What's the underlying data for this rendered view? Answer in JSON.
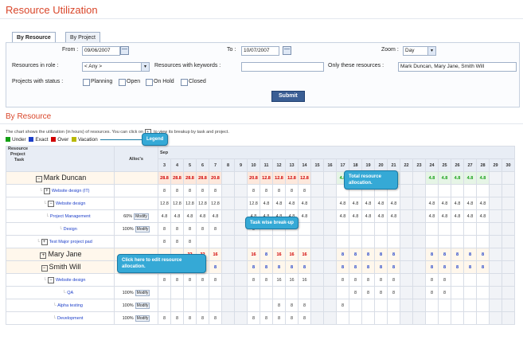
{
  "page": {
    "title": "Resource Utilization"
  },
  "tabs": [
    {
      "label": "By Resource",
      "active": true
    },
    {
      "label": "By Project",
      "active": false
    }
  ],
  "filters": {
    "from_label": "From :",
    "from_value": "09/06/2007",
    "to_label": "To :",
    "to_value": "10/07/2007",
    "zoom_label": "Zoom :",
    "zoom_value": "Day",
    "role_label": "Resources in role :",
    "role_value": "< Any >",
    "keywords_label": "Resources with keywords :",
    "keywords_value": "",
    "only_label": "Only these resources :",
    "only_value": "Mark Duncan, Mary Jane, Smith Will",
    "status_label": "Projects with status :",
    "statuses": [
      "Planning",
      "Open",
      "On Hold",
      "Closed"
    ],
    "submit_label": "Submit"
  },
  "section": {
    "title": "By Resource",
    "description": "The chart shows the utilization (in hours) of resources. You can click on ",
    "description_tail": " to view its breakup by task and project.",
    "legend": [
      {
        "label": "Under",
        "color": "#14a014"
      },
      {
        "label": "Exact",
        "color": "#1d3fc9"
      },
      {
        "label": "Over",
        "color": "#d10000"
      },
      {
        "label": "Vacation",
        "color": "#b8b800"
      }
    ]
  },
  "grid": {
    "head_resource": "Resource",
    "head_project": "Project",
    "head_task": "Task",
    "head_alloc": "Alloc's",
    "month": "Sep",
    "days": [
      "3",
      "4",
      "5",
      "6",
      "7",
      "8",
      "9",
      "10",
      "11",
      "12",
      "13",
      "14",
      "15",
      "16",
      "17",
      "18",
      "19",
      "20",
      "21",
      "22",
      "23",
      "24",
      "25",
      "26",
      "27",
      "28",
      "29",
      "30"
    ],
    "modify_label": "Modify",
    "rows": [
      {
        "name": "Mark Duncan",
        "level": 0,
        "toggle": "minus",
        "alloc": "",
        "kind": "over",
        "cells": [
          "28.8",
          "28.8",
          "28.8",
          "28.8",
          "20.8",
          "",
          "",
          "20.8",
          "12.8",
          "12.8",
          "12.8",
          "12.8",
          "",
          "",
          "4.8",
          "4.8",
          "4.8",
          "4.8",
          "4.8",
          "",
          "",
          "4.8",
          "4.8",
          "4.8",
          "4.8",
          "4.8",
          "",
          ""
        ]
      },
      {
        "name": "Website design (IT)",
        "level": 1,
        "toggle": "plus",
        "alloc": "",
        "kind": "plain",
        "cells": [
          "8",
          "8",
          "8",
          "8",
          "8",
          "",
          "",
          "8",
          "8",
          "8",
          "8",
          "8",
          "",
          "",
          "",
          "",
          "",
          "",
          "",
          "",
          "",
          "",
          "",
          "",
          "",
          "",
          "",
          ""
        ]
      },
      {
        "name": "Website design",
        "level": 1,
        "toggle": "minus",
        "alloc": "",
        "kind": "plain",
        "cells": [
          "12.8",
          "12.8",
          "12.8",
          "12.8",
          "12.8",
          "",
          "",
          "12.8",
          "4.8",
          "4.8",
          "4.8",
          "4.8",
          "",
          "",
          "4.8",
          "4.8",
          "4.8",
          "4.8",
          "4.8",
          "",
          "",
          "4.8",
          "4.8",
          "4.8",
          "4.8",
          "4.8",
          "",
          ""
        ]
      },
      {
        "name": "Project Management",
        "level": 2,
        "toggle": "",
        "alloc": "60%",
        "kind": "plain",
        "cells": [
          "4.8",
          "4.8",
          "4.8",
          "4.8",
          "4.8",
          "",
          "",
          "4.8",
          "4.8",
          "4.8",
          "4.8",
          "4.8",
          "",
          "",
          "4.8",
          "4.8",
          "4.8",
          "4.8",
          "4.8",
          "",
          "",
          "4.8",
          "4.8",
          "4.8",
          "4.8",
          "4.8",
          "",
          ""
        ]
      },
      {
        "name": "Design",
        "level": 2,
        "toggle": "",
        "alloc": "100%",
        "kind": "plain",
        "cells": [
          "8",
          "8",
          "8",
          "8",
          "8",
          "",
          "",
          "8",
          "",
          "",
          "",
          "",
          "",
          "",
          "",
          "",
          "",
          "",
          "",
          "",
          "",
          "",
          "",
          "",
          "",
          "",
          "",
          ""
        ]
      },
      {
        "name": "Test Major project pad",
        "level": 1,
        "toggle": "plus",
        "alloc": "",
        "kind": "plain",
        "cells": [
          "8",
          "8",
          "8",
          "",
          "",
          "",
          "",
          "",
          "",
          "",
          "",
          "",
          "",
          "",
          "",
          "",
          "",
          "",
          "",
          "",
          "",
          "",
          "",
          "",
          "",
          "",
          "",
          ""
        ]
      },
      {
        "name": "Mary Jane",
        "level": 0,
        "toggle": "plus",
        "alloc": "",
        "kind": "mixed",
        "cells": [
          "",
          "",
          "32",
          "32",
          "16",
          "",
          "",
          "16",
          "8",
          "16",
          "16",
          "16",
          "",
          "",
          "8",
          "8",
          "8",
          "8",
          "8",
          "",
          "",
          "8",
          "8",
          "8",
          "8",
          "8",
          "",
          ""
        ]
      },
      {
        "name": "Smith Will",
        "level": 0,
        "toggle": "minus",
        "alloc": "",
        "kind": "exact",
        "cells": [
          "8",
          "8",
          "8",
          "8",
          "8",
          "",
          "",
          "8",
          "8",
          "8",
          "8",
          "8",
          "",
          "",
          "8",
          "8",
          "8",
          "8",
          "8",
          "",
          "",
          "8",
          "8",
          "8",
          "8",
          "8",
          "",
          ""
        ]
      },
      {
        "name": "Website design",
        "level": 1,
        "toggle": "minus",
        "alloc": "",
        "kind": "plain",
        "cells": [
          "8",
          "8",
          "8",
          "8",
          "8",
          "",
          "",
          "8",
          "8",
          "16",
          "16",
          "16",
          "",
          "",
          "8",
          "8",
          "8",
          "8",
          "8",
          "",
          "",
          "8",
          "8",
          "",
          "",
          "",
          "",
          ""
        ]
      },
      {
        "name": "QA",
        "level": 2,
        "toggle": "",
        "alloc": "100%",
        "kind": "plain",
        "cells": [
          "",
          "",
          "",
          "",
          "",
          "",
          "",
          "",
          "",
          "",
          "",
          "",
          "",
          "",
          "",
          "8",
          "8",
          "8",
          "8",
          "",
          "",
          "8",
          "8",
          "",
          "",
          "",
          "",
          ""
        ]
      },
      {
        "name": "Alpha testing",
        "level": 2,
        "toggle": "",
        "alloc": "100%",
        "kind": "plain",
        "cells": [
          "",
          "",
          "",
          "",
          "",
          "",
          "",
          "",
          "",
          "8",
          "8",
          "8",
          "",
          "",
          "8",
          "",
          "",
          "",
          "",
          "",
          "",
          "",
          "",
          "",
          "",
          "",
          "",
          ""
        ]
      },
      {
        "name": "Development",
        "level": 2,
        "toggle": "",
        "alloc": "100%",
        "kind": "plain",
        "cells": [
          "8",
          "8",
          "8",
          "8",
          "8",
          "",
          "",
          "8",
          "8",
          "8",
          "8",
          "8",
          "",
          "",
          "",
          "",
          "",
          "",
          "",
          "",
          "",
          "",
          "",
          "",
          "",
          "",
          "",
          ""
        ]
      }
    ]
  },
  "callouts": {
    "legend": "Legend",
    "total": "Total resource allocation.",
    "task": "Task wise break-up",
    "edit": "Click here to edit resource allocation."
  }
}
